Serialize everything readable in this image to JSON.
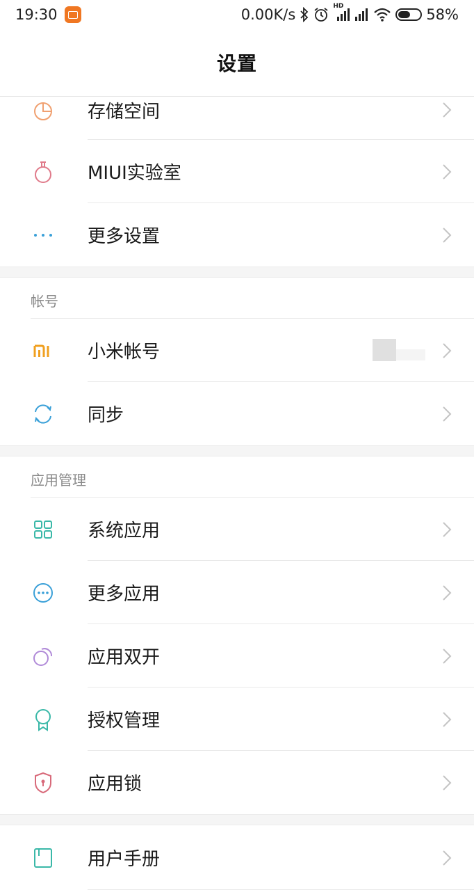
{
  "status_bar": {
    "time": "19:30",
    "app_icon": "mi-notification-icon",
    "network_speed": "0.00K/s",
    "icons": [
      "bluetooth-icon",
      "alarm-icon",
      "hd-signal-icon",
      "signal-icon",
      "wifi-icon",
      "battery-icon"
    ],
    "hd_label": "HD",
    "battery_level": 0.58,
    "battery_text": "58%"
  },
  "header": {
    "title": "设置"
  },
  "groups": [
    {
      "items": [
        {
          "label": "存储空间",
          "icon": "storage-pie-icon",
          "color": "#f0a070"
        },
        {
          "label": "MIUI实验室",
          "icon": "flask-icon",
          "color": "#e07a8a"
        },
        {
          "label": "更多设置",
          "icon": "more-dots-icon",
          "color": "#3aa0d8"
        }
      ]
    },
    {
      "title": "帐号",
      "items": [
        {
          "label": "小米帐号",
          "icon": "mi-logo-icon",
          "color": "#f0a020"
        },
        {
          "label": "同步",
          "icon": "sync-icon",
          "color": "#3aa0d8"
        }
      ]
    },
    {
      "title": "应用管理",
      "items": [
        {
          "label": "系统应用",
          "icon": "grid-apps-icon",
          "color": "#3ab8a8"
        },
        {
          "label": "更多应用",
          "icon": "more-apps-icon",
          "color": "#3aa0d8"
        },
        {
          "label": "应用双开",
          "icon": "dual-apps-icon",
          "color": "#b08ad8"
        },
        {
          "label": "授权管理",
          "icon": "badge-icon",
          "color": "#3ab8a8"
        },
        {
          "label": "应用锁",
          "icon": "shield-lock-icon",
          "color": "#d86a7a"
        }
      ]
    },
    {
      "items": [
        {
          "label": "用户手册",
          "icon": "book-icon",
          "color": "#3ab8a8"
        }
      ]
    }
  ],
  "colors": {
    "chevron": "#c4c4c4",
    "section_title": "#8a8a8a",
    "gap_bg": "#f5f5f5"
  }
}
